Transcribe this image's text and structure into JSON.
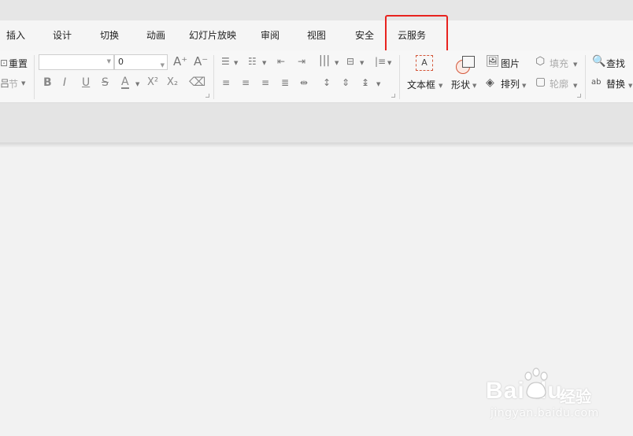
{
  "tabs": [
    "插入",
    "设计",
    "切换",
    "动画",
    "幻灯片放映",
    "审阅",
    "视图",
    "安全",
    "云服务"
  ],
  "ribbon": {
    "reset": "重置",
    "section": "节",
    "font_name": "",
    "font_size": "0",
    "bold": "B",
    "italic": "I",
    "underline": "U",
    "strike": "S",
    "font_color": "A",
    "superscript": "X²",
    "subscript": "X₂",
    "grow_font": "A⁺",
    "shrink_font": "A⁻",
    "textbox": "文本框",
    "shape": "形状",
    "picture": "图片",
    "arrange": "排列",
    "fill": "填充",
    "outline": "轮廓",
    "find": "查找",
    "replace": "替换"
  },
  "watermark": {
    "brand": "Bai du",
    "jingyan": "经验",
    "url": "jingyan.baidu.com"
  },
  "colors": {
    "highlight": "#e8231f",
    "accent_orange": "#d4573a"
  }
}
